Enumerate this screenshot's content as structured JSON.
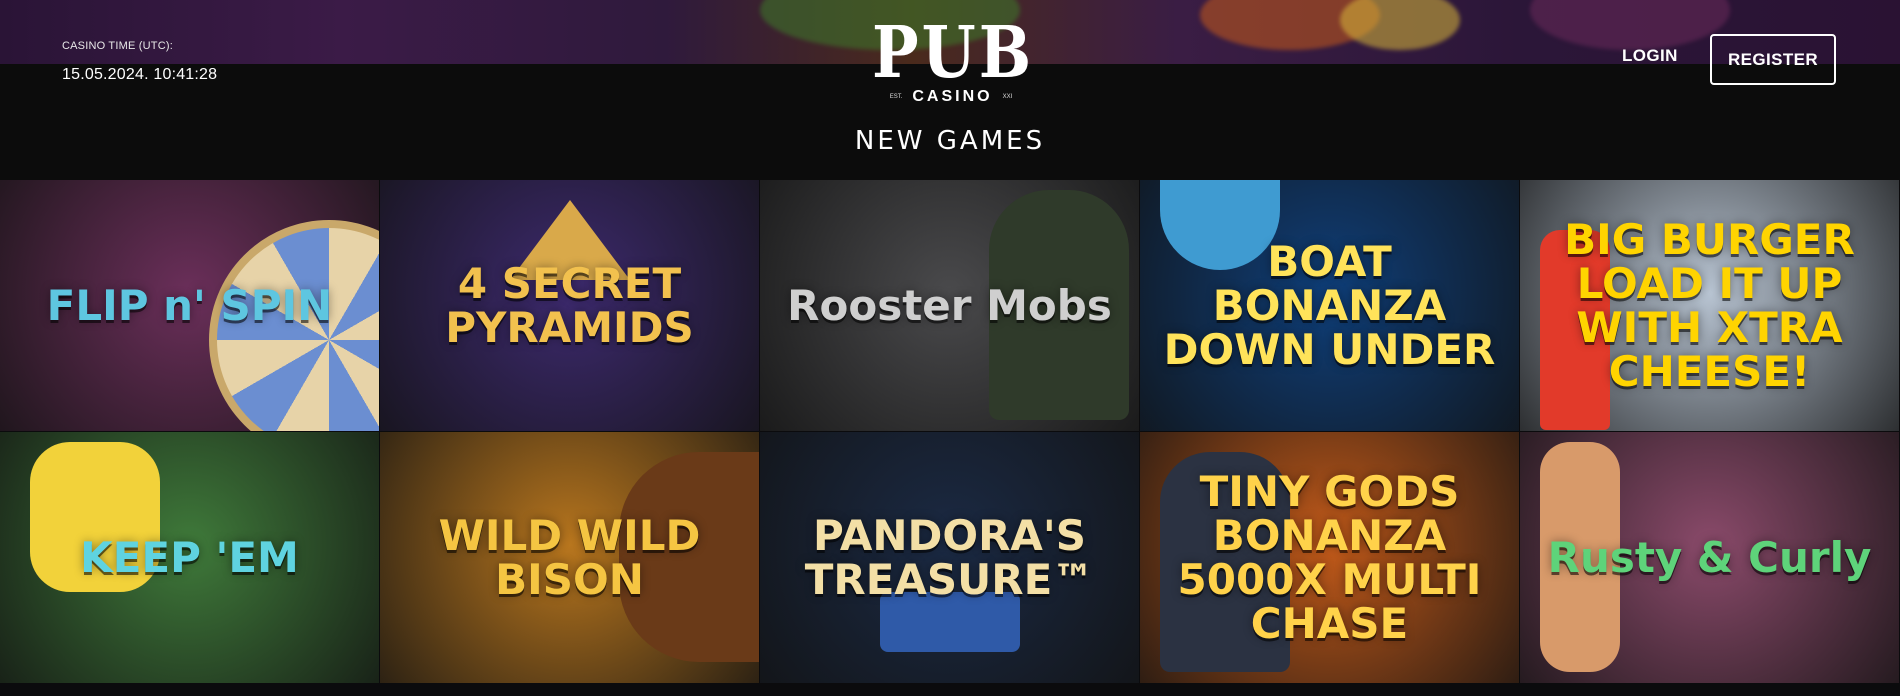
{
  "header": {
    "casino_time_label": "CASINO TIME (UTC):",
    "casino_time_value": "15.05.2024. 10:41:28",
    "logo_main": "PUB",
    "logo_est": "EST.",
    "logo_sub": "CASINO",
    "logo_year": "XXI",
    "login_label": "LOGIN",
    "register_label": "REGISTER"
  },
  "section_title": "NEW GAMES",
  "games": [
    {
      "title": "FLIP n' SPIN",
      "icon": "wheel-icon",
      "bg": "#6b2f5a",
      "text_color": "#5ec6e0"
    },
    {
      "title": "4 SECRET PYRAMIDS",
      "icon": "pyramid-icon",
      "bg": "#3d2a6e",
      "text_color": "#f2c14e"
    },
    {
      "title": "Rooster Mobs",
      "icon": "gangster-icon",
      "bg": "#4a4a4c",
      "text_color": "#cfcfcf"
    },
    {
      "title": "BOAT BONANZA DOWN UNDER",
      "icon": "shark-icon",
      "bg": "#0f3f7a",
      "text_color": "#ffe35a"
    },
    {
      "title": "BIG BURGER LOAD IT UP WITH XTRA CHEESE!",
      "icon": "ketchup-icon",
      "bg": "#b8c4d2",
      "text_color": "#ffd400"
    },
    {
      "title": "KEEP 'EM",
      "icon": "cartoon-character-icon",
      "bg": "#3f7a3a",
      "text_color": "#5fd3e0"
    },
    {
      "title": "WILD WILD BISON",
      "icon": "bison-icon",
      "bg": "#b8761e",
      "text_color": "#f5c542"
    },
    {
      "title": "PANDORA'S TREASURE™",
      "icon": "chest-icon",
      "bg": "#1b2a44",
      "text_color": "#f3dfa6"
    },
    {
      "title": "TINY GODS BONANZA 5000X MULTI CHASE",
      "icon": "anubis-icon",
      "bg": "#c25a1a",
      "text_color": "#ffd24a"
    },
    {
      "title": "Rusty & Curly",
      "icon": "cowboy-icon",
      "bg": "#8a4a6a",
      "text_color": "#5ed37a"
    }
  ]
}
